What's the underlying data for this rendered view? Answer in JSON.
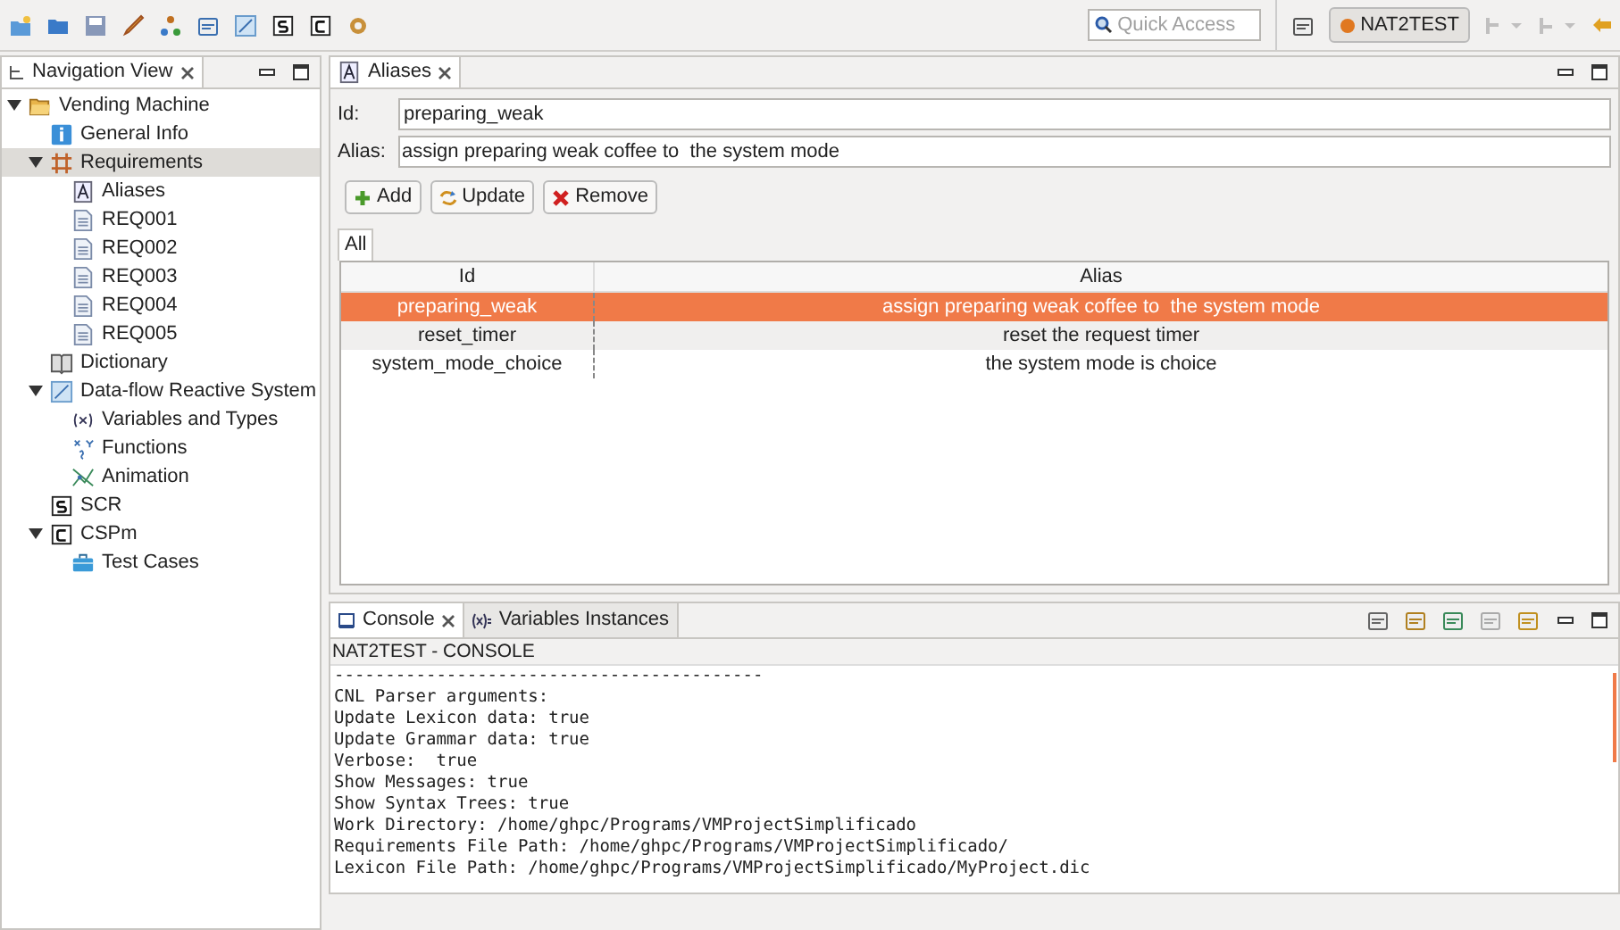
{
  "toolbar": {
    "quick_access": {
      "placeholder": "Quick Access"
    },
    "perspective": "NAT2TEST"
  },
  "navigation": {
    "title": "Navigation View",
    "tree": [
      {
        "label": "Vending Machine",
        "kind": "folder",
        "expanded": true,
        "selected": false,
        "children": [
          {
            "label": "General Info",
            "kind": "info",
            "selected": false
          },
          {
            "label": "Requirements",
            "kind": "grid",
            "expanded": true,
            "selected": true,
            "children": [
              {
                "label": "Aliases",
                "kind": "alias",
                "selected": false
              },
              {
                "label": "REQ001",
                "kind": "doc",
                "selected": false
              },
              {
                "label": "REQ002",
                "kind": "doc",
                "selected": false
              },
              {
                "label": "REQ003",
                "kind": "doc",
                "selected": false
              },
              {
                "label": "REQ004",
                "kind": "doc",
                "selected": false
              },
              {
                "label": "REQ005",
                "kind": "doc",
                "selected": false
              }
            ]
          },
          {
            "label": "Dictionary",
            "kind": "book",
            "selected": false
          },
          {
            "label": "Data-flow Reactive System",
            "kind": "chart",
            "expanded": true,
            "selected": false,
            "children": [
              {
                "label": "Variables and Types",
                "kind": "variables",
                "selected": false
              },
              {
                "label": "Functions",
                "kind": "functions",
                "selected": false
              },
              {
                "label": "Animation",
                "kind": "animation",
                "selected": false
              }
            ]
          },
          {
            "label": "SCR",
            "kind": "scr",
            "selected": false
          },
          {
            "label": "CSPm",
            "kind": "cspm",
            "expanded": true,
            "selected": false,
            "children": [
              {
                "label": "Test Cases",
                "kind": "case",
                "selected": false
              }
            ]
          }
        ]
      }
    ]
  },
  "editor": {
    "tab": "Aliases",
    "id_label": "Id:",
    "id_value": "preparing_weak",
    "alias_label": "Alias:",
    "alias_value": "assign preparing weak coffee to  the system mode",
    "buttons": [
      {
        "label": "Add",
        "kind": "add"
      },
      {
        "label": "Update",
        "kind": "update"
      },
      {
        "label": "Remove",
        "kind": "remove"
      }
    ],
    "table_tab": "All",
    "columns": [
      "Id",
      "Alias"
    ],
    "rows": [
      {
        "id": "preparing_weak",
        "alias": "assign preparing weak coffee to  the system mode",
        "selected": true
      },
      {
        "id": "reset_timer",
        "alias": "reset the request timer",
        "selected": false
      },
      {
        "id": "system_mode_choice",
        "alias": "the system mode is choice",
        "selected": false
      }
    ]
  },
  "console": {
    "tabs": [
      {
        "label": "Console",
        "selected": true
      },
      {
        "label": "Variables Instances",
        "selected": false
      }
    ],
    "title": "NAT2TEST - CONSOLE",
    "lines": [
      "------------------------------------------",
      "CNL Parser arguments:",
      "Update Lexicon data: true",
      "Update Grammar data: true",
      "Verbose:  true",
      "Show Messages: true",
      "Show Syntax Trees: true",
      "Work Directory: /home/ghpc/Programs/VMProjectSimplificado",
      "Requirements File Path: /home/ghpc/Programs/VMProjectSimplificado/",
      "Lexicon File Path: /home/ghpc/Programs/VMProjectSimplificado/MyProject.dic"
    ]
  }
}
